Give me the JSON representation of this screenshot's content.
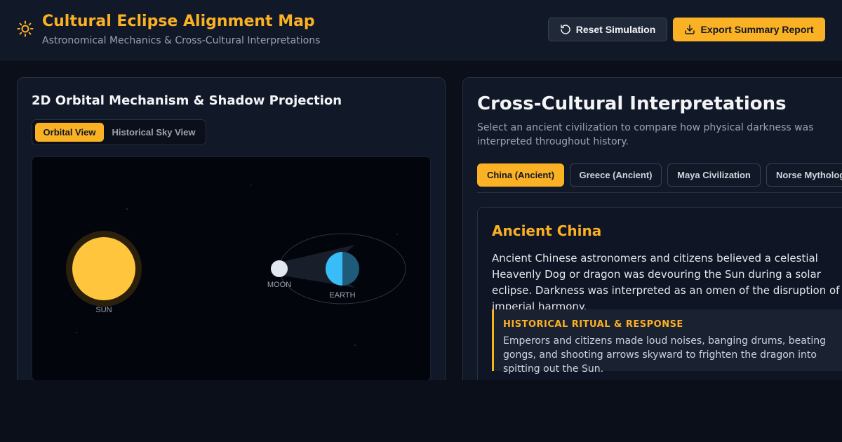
{
  "header": {
    "title": "Cultural Eclipse Alignment Map",
    "subtitle": "Astronomical Mechanics & Cross-Cultural Interpretations",
    "logo_icon": "sun-icon",
    "reset_label": "Reset Simulation",
    "reset_icon": "rotate-ccw-icon",
    "export_label": "Export Summary Report",
    "export_icon": "download-icon"
  },
  "orbital_panel": {
    "title": "2D Orbital Mechanism & Shadow Projection",
    "view_tabs": [
      {
        "label": "Orbital View",
        "active": true
      },
      {
        "label": "Historical Sky View",
        "active": false
      }
    ],
    "bodies": {
      "sun": "SUN",
      "moon": "MOON",
      "earth": "EARTH"
    }
  },
  "culture_panel": {
    "title": "Cross-Cultural Interpretations",
    "description": "Select an ancient civilization to compare how physical darkness was interpreted throughout history.",
    "tabs": [
      {
        "label": "China (Ancient)",
        "active": true
      },
      {
        "label": "Greece (Ancient)",
        "active": false
      },
      {
        "label": "Maya Civilization",
        "active": false
      },
      {
        "label": "Norse Mythology",
        "active": false
      }
    ],
    "selected": {
      "name": "Ancient China",
      "text": "Ancient Chinese astronomers and citizens believed a celestial Heavenly Dog or dragon was devouring the Sun during a solar eclipse. Darkness was interpreted as an omen of the disruption of imperial harmony.",
      "ritual_heading": "HISTORICAL RITUAL & RESPONSE",
      "ritual_text": "Emperors and citizens made loud noises, banging drums, beating gongs, and shooting arrows skyward to frighten the dragon into spitting out the Sun."
    }
  },
  "colors": {
    "accent": "#fbb124",
    "background": "#0b0f1a",
    "panel": "#111827",
    "sun": "#ffc53d",
    "earth_day": "#38bdf8",
    "earth_night": "#1e5a7a",
    "moon": "#e2e8f0"
  }
}
